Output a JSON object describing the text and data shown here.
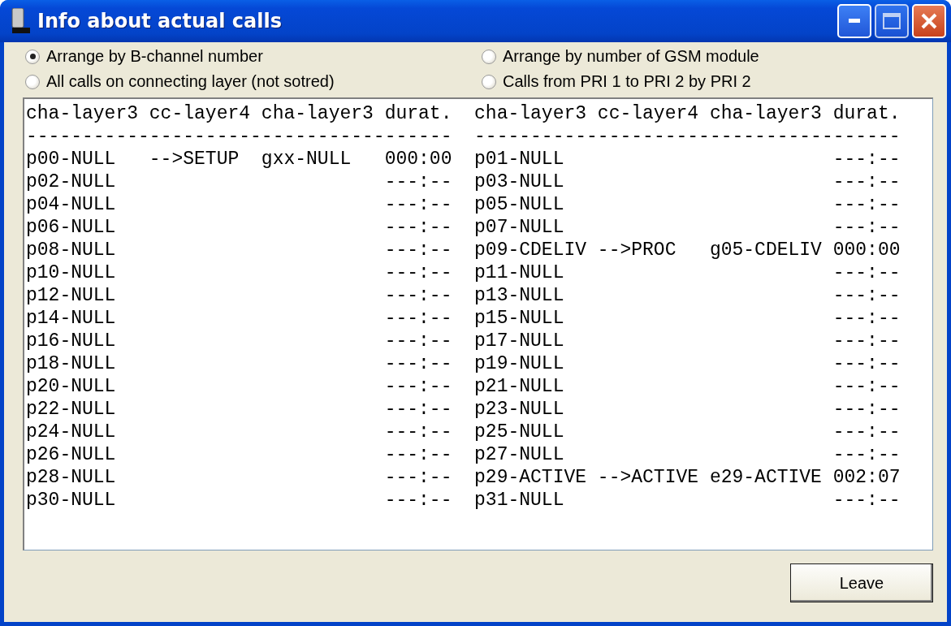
{
  "window": {
    "title": "Info about actual calls"
  },
  "sort_options": [
    {
      "label": "Arrange by B-channel number",
      "selected": true
    },
    {
      "label": "Arrange by number of GSM module",
      "selected": false
    },
    {
      "label": "All calls on connecting layer (not sotred)",
      "selected": false
    },
    {
      "label": "Calls from PRI 1 to PRI 2 by PRI 2",
      "selected": false
    }
  ],
  "panes": [
    {
      "columns": [
        "cha-layer3",
        "cc-layer4",
        "cha-layer3",
        "durat."
      ],
      "rule": "--------------------------------------",
      "rows": [
        {
          "channel": "p00-NULL",
          "cc_state": "-->SETUP",
          "peer": "gxx-NULL",
          "duration": "000:00"
        },
        {
          "channel": "p02-NULL",
          "duration": "---:--"
        },
        {
          "channel": "p04-NULL",
          "duration": "---:--"
        },
        {
          "channel": "p06-NULL",
          "duration": "---:--"
        },
        {
          "channel": "p08-NULL",
          "duration": "---:--"
        },
        {
          "channel": "p10-NULL",
          "duration": "---:--"
        },
        {
          "channel": "p12-NULL",
          "duration": "---:--"
        },
        {
          "channel": "p14-NULL",
          "duration": "---:--"
        },
        {
          "channel": "p16-NULL",
          "duration": "---:--"
        },
        {
          "channel": "p18-NULL",
          "duration": "---:--"
        },
        {
          "channel": "p20-NULL",
          "duration": "---:--"
        },
        {
          "channel": "p22-NULL",
          "duration": "---:--"
        },
        {
          "channel": "p24-NULL",
          "duration": "---:--"
        },
        {
          "channel": "p26-NULL",
          "duration": "---:--"
        },
        {
          "channel": "p28-NULL",
          "duration": "---:--"
        },
        {
          "channel": "p30-NULL",
          "duration": "---:--"
        }
      ]
    },
    {
      "columns": [
        "cha-layer3",
        "cc-layer4",
        "cha-layer3",
        "durat."
      ],
      "rule": "--------------------------------------",
      "rows": [
        {
          "channel": "p01-NULL",
          "duration": "---:--"
        },
        {
          "channel": "p03-NULL",
          "duration": "---:--"
        },
        {
          "channel": "p05-NULL",
          "duration": "---:--"
        },
        {
          "channel": "p07-NULL",
          "duration": "---:--"
        },
        {
          "channel": "p09-CDELIV",
          "cc_state": "-->PROC",
          "peer": "g05-CDELIV",
          "duration": "000:00"
        },
        {
          "channel": "p11-NULL",
          "duration": "---:--"
        },
        {
          "channel": "p13-NULL",
          "duration": "---:--"
        },
        {
          "channel": "p15-NULL",
          "duration": "---:--"
        },
        {
          "channel": "p17-NULL",
          "duration": "---:--"
        },
        {
          "channel": "p19-NULL",
          "duration": "---:--"
        },
        {
          "channel": "p21-NULL",
          "duration": "---:--"
        },
        {
          "channel": "p23-NULL",
          "duration": "---:--"
        },
        {
          "channel": "p25-NULL",
          "duration": "---:--"
        },
        {
          "channel": "p27-NULL",
          "duration": "---:--"
        },
        {
          "channel": "p29-ACTIVE",
          "cc_state": "-->ACTIVE",
          "peer": "e29-ACTIVE",
          "duration": "002:07"
        },
        {
          "channel": "p31-NULL",
          "duration": "---:--"
        }
      ]
    }
  ],
  "buttons": [
    "Leave"
  ]
}
